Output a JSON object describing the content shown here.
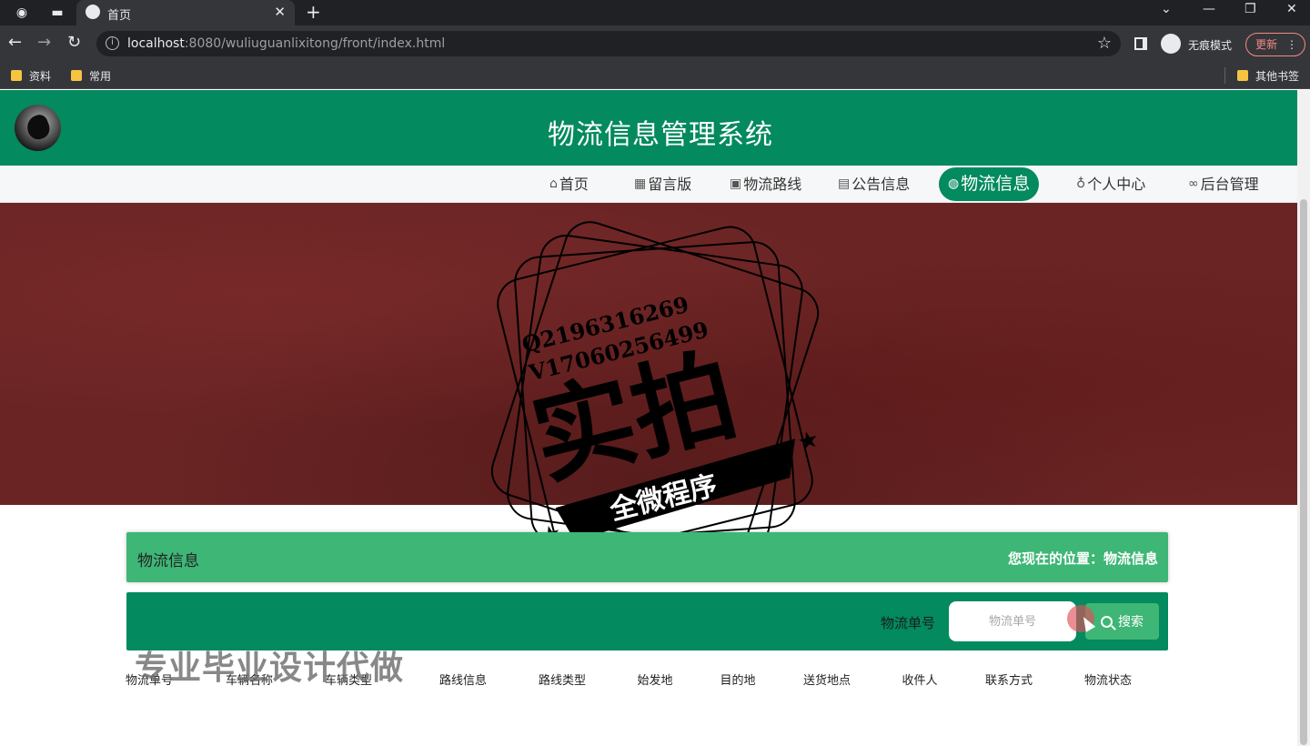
{
  "browser": {
    "tab_title": "首页",
    "url_host": "localhost",
    "url_rest": ":8080/wuliuguanlixitong/front/index.html",
    "incognito_label": "无痕模式",
    "update_label": "更新",
    "bookmarks": [
      "资料",
      "常用"
    ],
    "other_bookmarks": "其他书签"
  },
  "site": {
    "title": "物流信息管理系统"
  },
  "nav": {
    "items": [
      {
        "label": "首页",
        "icon": "home-icon"
      },
      {
        "label": "留言版",
        "icon": "grid-icon"
      },
      {
        "label": "物流路线",
        "icon": "gift-icon"
      },
      {
        "label": "公告信息",
        "icon": "printer-icon"
      },
      {
        "label": "物流信息",
        "icon": "globe-icon",
        "active": true
      },
      {
        "label": "个人中心",
        "icon": "user-icon"
      },
      {
        "label": "后台管理",
        "icon": "link-icon"
      }
    ]
  },
  "watermark": {
    "line1": "Q2196316269",
    "line2": "V17060256499",
    "big": "实拍",
    "ribbon": "全微程序"
  },
  "section": {
    "title": "物流信息",
    "location": "您现在的位置：物流信息"
  },
  "search": {
    "label": "物流单号",
    "placeholder": "物流单号",
    "button": "搜索"
  },
  "table": {
    "headers": [
      "物流单号",
      "车辆名称",
      "车辆类型",
      "路线信息",
      "路线类型",
      "始发地",
      "目的地",
      "送货地点",
      "收件人",
      "联系方式",
      "物流状态"
    ]
  },
  "overlay": {
    "text": "专业毕业设计代做"
  },
  "colors": {
    "primary": "#038a5e",
    "accent": "#3eb675",
    "banner": "#6a2424"
  }
}
